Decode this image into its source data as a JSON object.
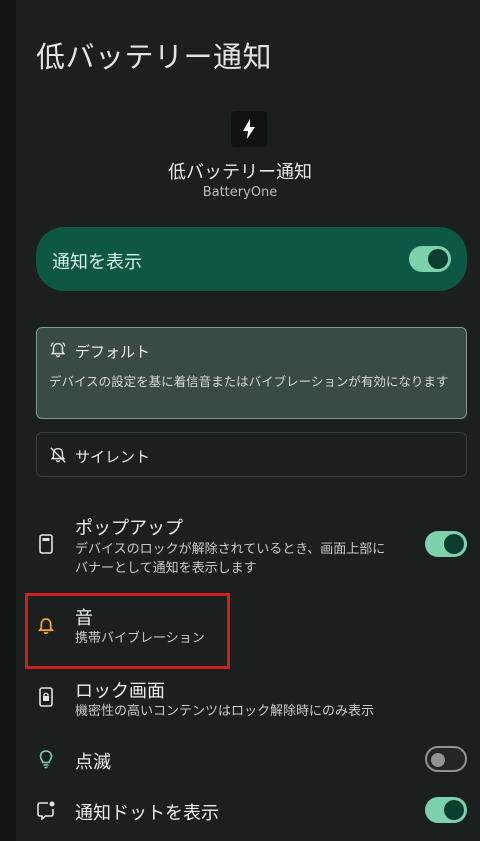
{
  "header": {
    "title": "低バッテリー通知"
  },
  "app_info": {
    "channel_name": "低バッテリー通知",
    "app_name": "BatteryOne",
    "icon": "lightning-bolt-icon"
  },
  "show_notifications": {
    "label": "通知を表示",
    "enabled": true
  },
  "importance": {
    "default": {
      "title": "デフォルト",
      "description": "デバイスの設定を基に着信音またはバイブレーションが有効になります",
      "selected": true,
      "icon": "bell-ring-icon"
    },
    "silent": {
      "title": "サイレント",
      "selected": false,
      "icon": "bell-off-icon"
    }
  },
  "settings": {
    "popup": {
      "title": "ポップアップ",
      "description_line1": "デバイスのロックが解除されているとき、画面上部に",
      "description_line2": "バナーとして通知を表示します",
      "enabled": true,
      "icon": "phone-icon"
    },
    "sound": {
      "title": "音",
      "description": "携帯バイブレーション",
      "icon": "bell-icon"
    },
    "lock_screen": {
      "title": "ロック画面",
      "description": "機密性の高いコンテンツはロック解除時にのみ表示",
      "icon": "lock-screen-icon"
    },
    "blink": {
      "title": "点滅",
      "enabled": false,
      "icon": "lightbulb-icon"
    },
    "dot": {
      "title": "通知ドットを表示",
      "enabled": true,
      "icon": "notification-dot-icon"
    }
  },
  "colors": {
    "accent": "#7dd1ad",
    "card": "#0f5745",
    "highlight": "#d11e1e",
    "sound_icon": "#f2a33a"
  }
}
